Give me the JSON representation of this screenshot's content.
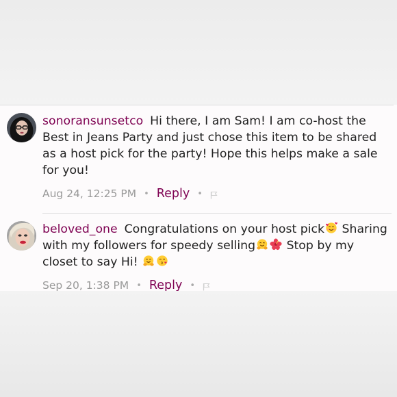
{
  "comments": [
    {
      "username": "sonoransunsetco",
      "body": "Hi there, I am Sam! I am co-host the Best in Jeans Party and just chose this item to be shared as a host pick for the party! Hope this helps make a sale for you!",
      "timestamp": "Aug 24, 12:25 PM",
      "reply_label": "Reply",
      "separator": "•",
      "avatar_icon": "avatar-dark-hair-glasses",
      "flag_icon": "flag-icon"
    },
    {
      "username": "beloved_one",
      "body_parts": [
        "Congratulations on your host pick",
        "Sharing with my followers for speedy selling",
        "Stop by my closet to say Hi!"
      ],
      "emojis": [
        "smiling-face-with-hearts",
        "hugging-face",
        "hibiscus",
        "hugging-face",
        "face-blowing-kiss"
      ],
      "timestamp": "Sep 20, 1:38 PM",
      "reply_label": "Reply",
      "separator": "•",
      "avatar_icon": "avatar-blonde-hair",
      "flag_icon": "flag-icon"
    }
  ],
  "colors": {
    "username": "#7f0353",
    "reply": "#7f0353",
    "body_text": "#222222",
    "meta_text": "#999999",
    "panel_bg": "#fdfbfc",
    "outer_bg": "#ebebeb"
  }
}
